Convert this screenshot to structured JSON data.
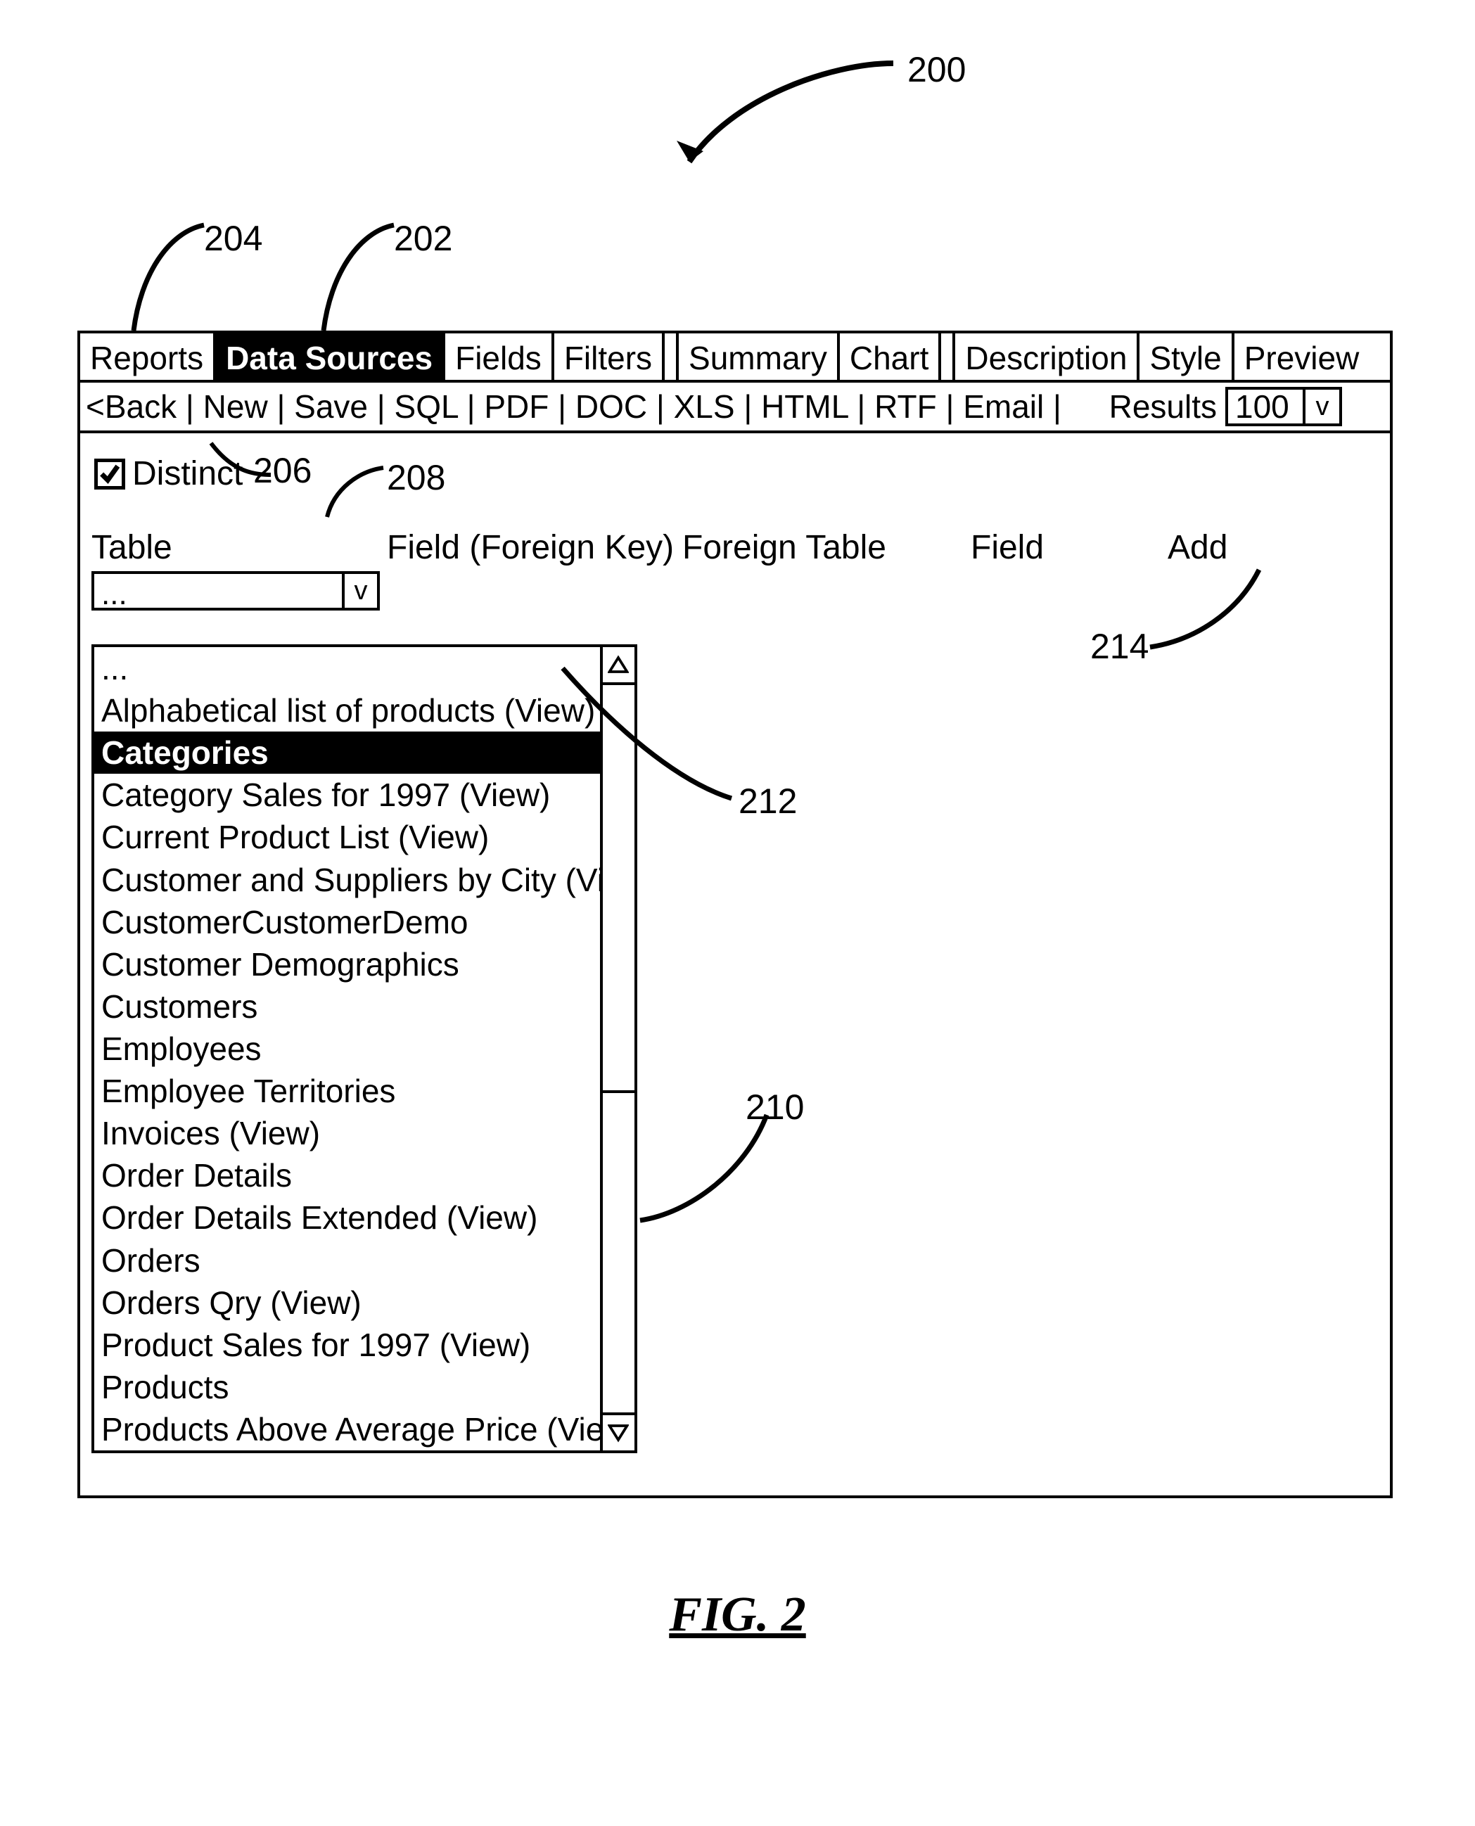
{
  "figure_label": "FIG. 2",
  "callouts": {
    "c200": "200",
    "c204": "204",
    "c202": "202",
    "c206": "206",
    "c208": "208",
    "c210": "210",
    "c212": "212",
    "c214": "214"
  },
  "tabs": [
    "Reports",
    "Data Sources",
    "Fields",
    "Filters",
    "Summary",
    "Chart",
    "Description",
    "Style",
    "Preview"
  ],
  "active_tab_index": 1,
  "toolbar_text": "<Back | New | Save | SQL | PDF | DOC | XLS | HTML | RTF | Email |",
  "results_label": "Results",
  "results_value": "100",
  "results_caret": "v",
  "distinct_label": "Distinct",
  "columns": {
    "col1": "Table",
    "col2": "Field (Foreign Key)",
    "col3": "Foreign Table",
    "col4": "Field",
    "col5": "Add"
  },
  "table_select_value": "...",
  "table_select_caret": "v",
  "dropdown_items": [
    {
      "label": "...",
      "selected": false
    },
    {
      "label": "Alphabetical list of products (View)",
      "selected": false
    },
    {
      "label": "Categories",
      "selected": true
    },
    {
      "label": "Category Sales for 1997 (View)",
      "selected": false
    },
    {
      "label": "Current Product List (View)",
      "selected": false
    },
    {
      "label": "Customer and Suppliers by City (View",
      "selected": false
    },
    {
      "label": "CustomerCustomerDemo",
      "selected": false
    },
    {
      "label": "Customer Demographics",
      "selected": false
    },
    {
      "label": "Customers",
      "selected": false
    },
    {
      "label": "Employees",
      "selected": false
    },
    {
      "label": "Employee Territories",
      "selected": false
    },
    {
      "label": "Invoices (View)",
      "selected": false
    },
    {
      "label": "Order Details",
      "selected": false
    },
    {
      "label": "Order Details Extended (View)",
      "selected": false
    },
    {
      "label": "Orders",
      "selected": false
    },
    {
      "label": "Orders Qry (View)",
      "selected": false
    },
    {
      "label": "Product Sales for 1997 (View)",
      "selected": false
    },
    {
      "label": "Products",
      "selected": false
    },
    {
      "label": "Products Above Average Price (View)",
      "selected": false
    }
  ]
}
